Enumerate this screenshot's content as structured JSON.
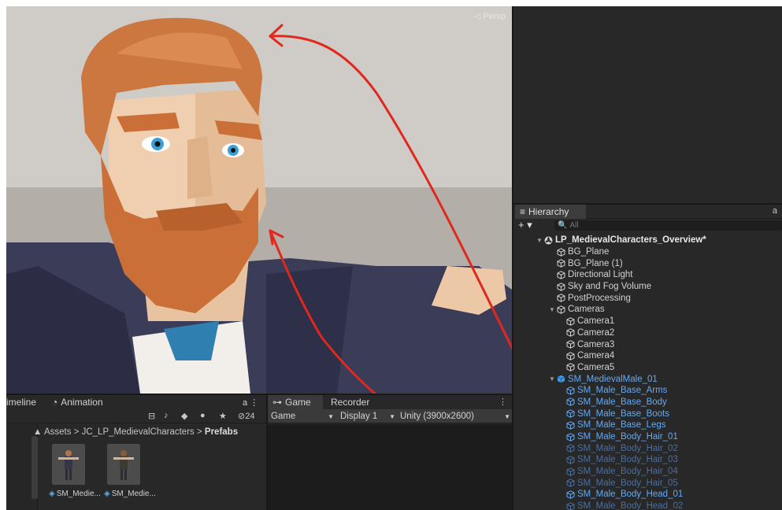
{
  "scene": {
    "overlay_label": "◁ Persp",
    "colors": {
      "background": "#b9b4ae",
      "annotation": "#e0281e"
    }
  },
  "hierarchy": {
    "tab_label": "Hierarchy",
    "add_label": "+ ▾",
    "search_placeholder": "All",
    "lock_label": "a",
    "items": [
      {
        "label": "LP_MedievalCharacters_Overview*",
        "depth": 0,
        "icon": "scene-icon",
        "style": "bold",
        "arrow": "▼"
      },
      {
        "label": "BG_Plane",
        "depth": 1,
        "icon": "cube-icon",
        "style": "normal",
        "arrow": ""
      },
      {
        "label": "BG_Plane (1)",
        "depth": 1,
        "icon": "cube-icon",
        "style": "normal",
        "arrow": ""
      },
      {
        "label": "Directional Light",
        "depth": 1,
        "icon": "cube-icon",
        "style": "normal",
        "arrow": ""
      },
      {
        "label": "Sky and Fog Volume",
        "depth": 1,
        "icon": "cube-icon",
        "style": "normal",
        "arrow": ""
      },
      {
        "label": "PostProcessing",
        "depth": 1,
        "icon": "cube-icon",
        "style": "normal",
        "arrow": ""
      },
      {
        "label": "Cameras",
        "depth": 1,
        "icon": "cube-icon",
        "style": "normal",
        "arrow": "▼"
      },
      {
        "label": "Camera1",
        "depth": 2,
        "icon": "cube-icon",
        "style": "normal",
        "arrow": ""
      },
      {
        "label": "Camera2",
        "depth": 2,
        "icon": "cube-icon",
        "style": "normal",
        "arrow": ""
      },
      {
        "label": "Camera3",
        "depth": 2,
        "icon": "cube-icon",
        "style": "normal",
        "arrow": ""
      },
      {
        "label": "Camera4",
        "depth": 2,
        "icon": "cube-icon",
        "style": "normal",
        "arrow": ""
      },
      {
        "label": "Camera5",
        "depth": 2,
        "icon": "cube-icon",
        "style": "normal",
        "arrow": ""
      },
      {
        "label": "SM_MedievalMale_01",
        "depth": 1,
        "icon": "prefab-icon",
        "style": "prefab",
        "arrow": "▼"
      },
      {
        "label": "SM_Male_Base_Arms",
        "depth": 2,
        "icon": "cube-icon",
        "style": "prefab",
        "arrow": ""
      },
      {
        "label": "SM_Male_Base_Body",
        "depth": 2,
        "icon": "cube-icon",
        "style": "prefab",
        "arrow": ""
      },
      {
        "label": "SM_Male_Base_Boots",
        "depth": 2,
        "icon": "cube-icon",
        "style": "prefab",
        "arrow": ""
      },
      {
        "label": "SM_Male_Base_Legs",
        "depth": 2,
        "icon": "cube-icon",
        "style": "prefab",
        "arrow": ""
      },
      {
        "label": "SM_Male_Body_Hair_01",
        "depth": 2,
        "icon": "cube-icon",
        "style": "prefab",
        "arrow": ""
      },
      {
        "label": "SM_Male_Body_Hair_02",
        "depth": 2,
        "icon": "cube-icon",
        "style": "prefab-dim",
        "arrow": ""
      },
      {
        "label": "SM_Male_Body_Hair_03",
        "depth": 2,
        "icon": "cube-icon",
        "style": "prefab-dim",
        "arrow": ""
      },
      {
        "label": "SM_Male_Body_Hair_04",
        "depth": 2,
        "icon": "cube-icon",
        "style": "prefab-dim",
        "arrow": ""
      },
      {
        "label": "SM_Male_Body_Hair_05",
        "depth": 2,
        "icon": "cube-icon",
        "style": "prefab-dim",
        "arrow": ""
      },
      {
        "label": "SM_Male_Body_Head_01",
        "depth": 2,
        "icon": "cube-icon",
        "style": "prefab",
        "arrow": ""
      },
      {
        "label": "SM_Male_Body_Head_02",
        "depth": 2,
        "icon": "cube-icon",
        "style": "prefab-dim",
        "arrow": ""
      }
    ]
  },
  "project": {
    "tabs": [
      "imeline",
      "Animation"
    ],
    "lock_label": "a ⋮",
    "hidden_count": "24",
    "breadcrumb": [
      "Assets",
      "JC_LP_MedievalCharacters",
      "Prefabs"
    ],
    "breadcrumb_sep": ">",
    "assets": [
      {
        "label": "SM_Medie..."
      },
      {
        "label": "SM_Medie..."
      }
    ]
  },
  "game": {
    "tabs": [
      "Game",
      "Recorder"
    ],
    "kebab": "⋮",
    "mode": "Game",
    "display": "Display 1",
    "resolution": "Unity (3900x2600)"
  }
}
